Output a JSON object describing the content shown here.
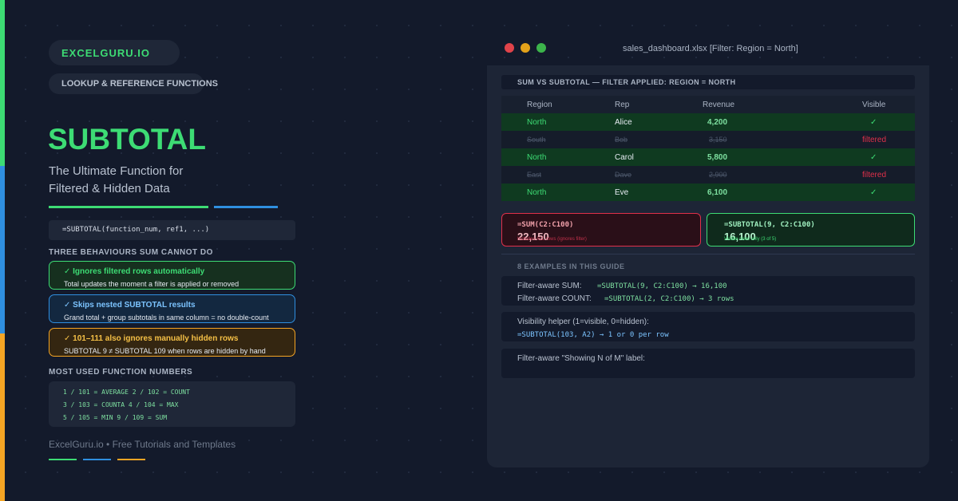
{
  "brand": {
    "name": "EXCELGURU.IO",
    "category": "LOOKUP & REFERENCE FUNCTIONS"
  },
  "hero": {
    "title": "SUBTOTAL",
    "subtitle_line1": "The Ultimate Function for",
    "subtitle_line2": "Filtered & Hidden Data"
  },
  "syntax": "=SUBTOTAL(function_num, ref1, ...)",
  "behaviours": {
    "heading": "THREE BEHAVIOURS SUM CANNOT DO",
    "items": [
      {
        "title": "✓ Ignores filtered rows automatically",
        "desc": "Total updates the moment a filter is applied or removed",
        "color": "#3ddc74"
      },
      {
        "title": "✓ Skips nested SUBTOTAL results",
        "desc": "Grand total + group subtotals in same column = no double-count",
        "color": "#2f8fe0"
      },
      {
        "title": "✓ 101–111 also ignores manually hidden rows",
        "desc": "SUBTOTAL 9 ≠ SUBTOTAL 109 when rows are hidden by hand",
        "color": "#f5a524"
      }
    ]
  },
  "function_numbers": {
    "heading": "MOST USED FUNCTION NUMBERS",
    "lines": [
      "1 / 101 = AVERAGE 2 / 102 = COUNT",
      "3 / 103 = COUNTA 4 / 104 = MAX",
      "5 / 105 = MIN 9 / 109 = SUM"
    ]
  },
  "footer": "ExcelGuru.io • Free Tutorials and Templates",
  "window": {
    "title": "sales_dashboard.xlsx [Filter: Region = North]",
    "section_label": "SUM VS SUBTOTAL — FILTER APPLIED: REGION = NORTH",
    "table": {
      "headers": [
        "Region",
        "Rep",
        "Revenue",
        "Visible"
      ],
      "rows": [
        {
          "region": "North",
          "rep": "Alice",
          "revenue": "4,200",
          "visible": "✓"
        },
        {
          "region": "South",
          "rep": "Bob",
          "revenue": "3,150",
          "visible": "filtered"
        },
        {
          "region": "North",
          "rep": "Carol",
          "revenue": "5,800",
          "visible": "✓"
        },
        {
          "region": "East",
          "rep": "Dave",
          "revenue": "2,900",
          "visible": "filtered"
        },
        {
          "region": "North",
          "rep": "Eve",
          "revenue": "6,100",
          "visible": "✓"
        }
      ]
    },
    "sum_card": {
      "formula": "=SUM(C2:C100)",
      "value": "22,150",
      "note": "Includes ALL rows (ignores filter)"
    },
    "subtotal_card": {
      "formula": "=SUBTOTAL(9, C2:C100)",
      "value": "16,100",
      "note": "Visible rows only (3 of 5)"
    },
    "examples_label": "8 EXAMPLES IN THIS GUIDE",
    "examples": {
      "ex1_label": "Filter-aware SUM:",
      "ex1_formula": "=SUBTOTAL(9, C2:C100) → 16,100",
      "ex2_label": "Filter-aware COUNT:",
      "ex2_formula": "=SUBTOTAL(2, C2:C100) → 3 rows",
      "ex3_label": "Visibility helper (1=visible, 0=hidden):",
      "ex3_formula": "=SUBTOTAL(103, A2) → 1 or 0 per row",
      "ex4_label": "Filter-aware \"Showing N of M\" label:"
    }
  },
  "colors": {
    "green": "#3ddc74",
    "blue": "#2f8fe0",
    "orange": "#f5a524",
    "red": "#e0304a",
    "background": "#131a2b"
  }
}
